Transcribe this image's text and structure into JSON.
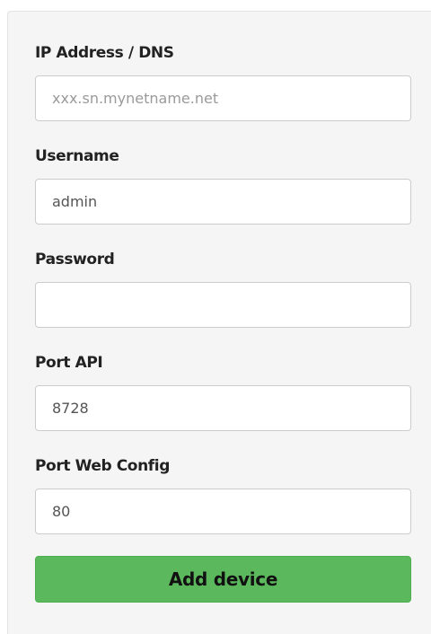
{
  "form": {
    "ip": {
      "label": "IP Address / DNS",
      "placeholder": "xxx.sn.mynetname.net",
      "value": ""
    },
    "username": {
      "label": "Username",
      "value": "admin"
    },
    "password": {
      "label": "Password",
      "value": ""
    },
    "port_api": {
      "label": "Port API",
      "value": "8728"
    },
    "port_web": {
      "label": "Port Web Config",
      "value": "80"
    },
    "submit_label": "Add device"
  },
  "colors": {
    "panel_bg": "#f5f5f5",
    "button_bg": "#5cb85c",
    "input_border": "#cccccc"
  }
}
